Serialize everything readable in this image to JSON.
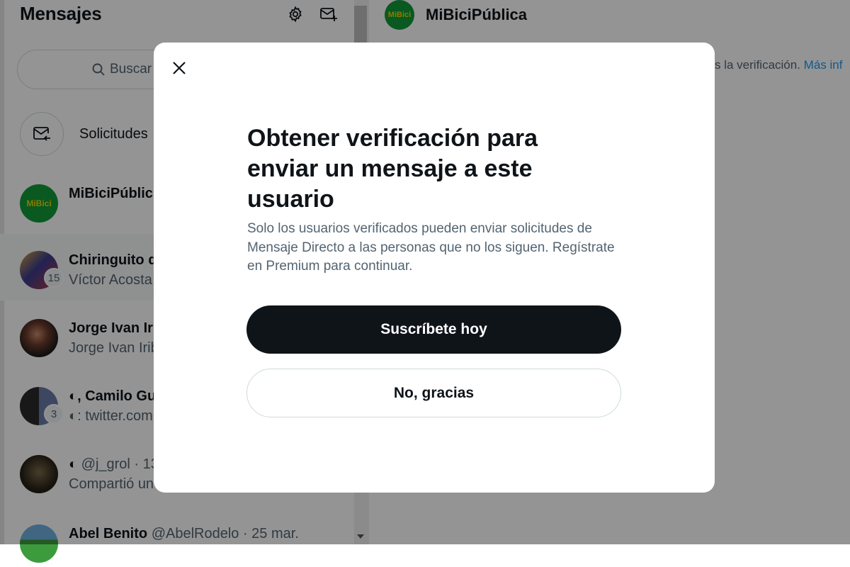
{
  "sidebar": {
    "title": "Mensajes",
    "search_placeholder": "Buscar",
    "requests_label": "Solicitudes"
  },
  "conversations": [
    {
      "name": "MiBiciPúblic",
      "preview": "",
      "badge": "",
      "avatar_text": "MiBici"
    },
    {
      "name": "Chiringuito d",
      "preview": "Víctor Acosta",
      "badge": "15"
    },
    {
      "name": "Jorge Ivan Iri",
      "preview": "Jorge Ivan Irib",
      "badge": ""
    },
    {
      "name": "◐, Camilo Gu",
      "preview": "◐: twitter.com",
      "badge": "3"
    },
    {
      "name": "◐",
      "handle": "@j_grol · 13",
      "preview": "Compartió un",
      "badge": ""
    },
    {
      "name": "Abel Benito",
      "handle": "@AbelRodelo · 25 mar.",
      "preview": "",
      "badge": ""
    }
  ],
  "chat": {
    "title": "MiBiciPública",
    "avatar_text": "MiBici",
    "notice_text": "s la verificación.",
    "notice_link": "Más inf"
  },
  "modal": {
    "title": "Obtener verificación para enviar un mensaje a este usuario",
    "description": "Solo los usuarios verificados pueden enviar solicitudes de Mensaje Directo a las personas que no los siguen. Regístrate en Premium para continuar.",
    "primary_button": "Suscríbete hoy",
    "secondary_button": "No, gracias"
  },
  "colors": {
    "accent": "#1d9bf0",
    "dark_button": "#0f1419",
    "brand_green": "#109a3a",
    "brand_yellow": "#f0d400"
  },
  "icons": {
    "settings": "gear-icon",
    "new_message": "new-message-icon",
    "search": "search-icon",
    "requests": "mail-return-icon",
    "close": "close-icon"
  }
}
